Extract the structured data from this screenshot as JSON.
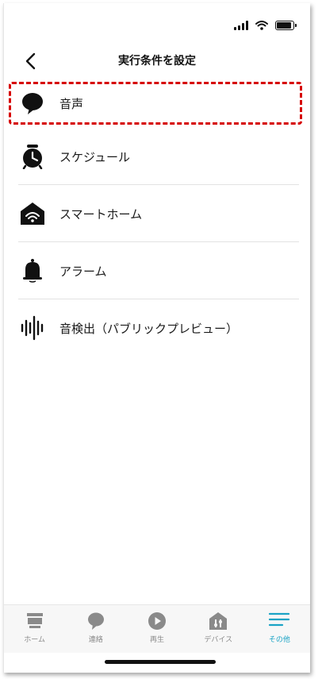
{
  "header": {
    "title": "実行条件を設定"
  },
  "list": {
    "items": [
      {
        "label": "音声",
        "icon": "speech-bubble-icon",
        "highlighted": true
      },
      {
        "label": "スケジュール",
        "icon": "alarm-clock-icon"
      },
      {
        "label": "スマートホーム",
        "icon": "smart-home-icon"
      },
      {
        "label": "アラーム",
        "icon": "bell-icon"
      },
      {
        "label": "音検出（パブリックプレビュー）",
        "icon": "sound-wave-icon"
      }
    ]
  },
  "tabbar": {
    "tabs": [
      {
        "label": "ホーム",
        "icon": "home-icon"
      },
      {
        "label": "連絡",
        "icon": "chat-icon"
      },
      {
        "label": "再生",
        "icon": "play-icon"
      },
      {
        "label": "デバイス",
        "icon": "devices-icon"
      },
      {
        "label": "その他",
        "icon": "menu-icon",
        "active": true
      }
    ]
  },
  "colors": {
    "highlight": "#d60000",
    "accent": "#1aa3c5",
    "inactive": "#8a8a8a"
  }
}
